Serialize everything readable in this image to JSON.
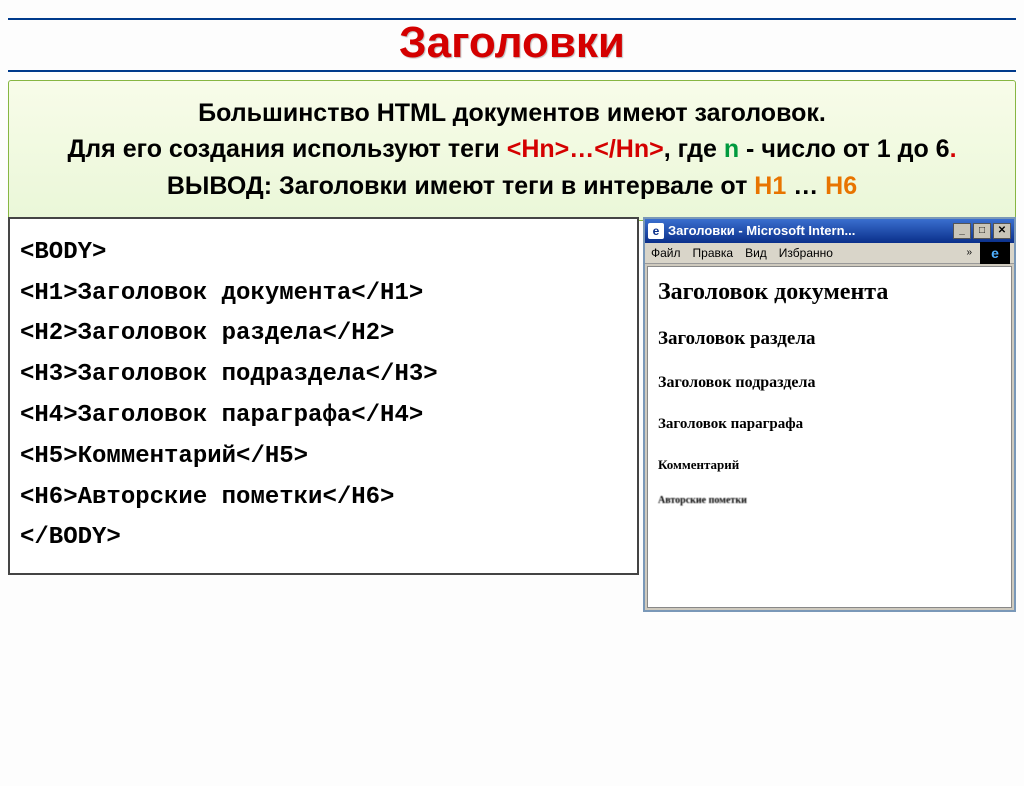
{
  "title": "Заголовки",
  "info": {
    "line1": "Большинство HTML документов имеют заголовок.",
    "line2a": "Для его создания используют теги ",
    "tag_open": "<Hn>",
    "dots": "…",
    "tag_close": "</Hn>",
    "line2b": ", где ",
    "n_var": "n",
    "line2c": " - число от 1 до 6",
    "period": ".",
    "line3a": "ВЫВОД: Заголовки имеют теги в интервале от ",
    "h1": "H1",
    "ellipsis": " … ",
    "h6": "H6"
  },
  "code": {
    "l1": "<BODY>",
    "l2": "<H1>Заголовок документа</H1>",
    "l3": "<H2>Заголовок раздела</H2>",
    "l4": "<H3>Заголовок подраздела</H3>",
    "l5": "<H4>Заголовок параграфа</H4>",
    "l6": "<H5>Комментарий</H5>",
    "l7": "<H6>Авторские пометки</H6>",
    "l8": "</BODY>"
  },
  "ie": {
    "title": "Заголовки - Microsoft Intern...",
    "menu": {
      "file": "Файл",
      "edit": "Правка",
      "view": "Вид",
      "fav": "Избранно"
    },
    "content": {
      "h1": "Заголовок документа",
      "h2": "Заголовок раздела",
      "h3": "Заголовок подраздела",
      "h4": "Заголовок параграфа",
      "h5": "Комментарий",
      "h6": "Авторские пометки"
    }
  }
}
